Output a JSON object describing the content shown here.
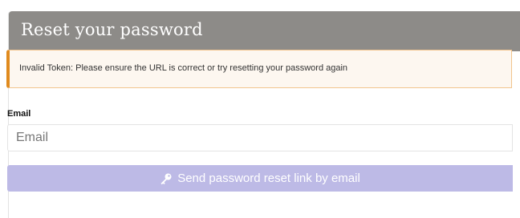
{
  "header": {
    "title": "Reset your password"
  },
  "alert": {
    "message": "Invalid Token: Please ensure the URL is correct or try resetting your password again",
    "type": "warning"
  },
  "form": {
    "email_label": "Email",
    "email_value": "",
    "email_placeholder": "Email",
    "submit_label": "Send password reset link by email",
    "submit_icon": "key-icon"
  },
  "colors": {
    "header_bg": "#8d8b88",
    "alert_accent": "#e08a1e",
    "alert_bg": "#fdf7f0",
    "button_bg": "#bdbae6"
  }
}
